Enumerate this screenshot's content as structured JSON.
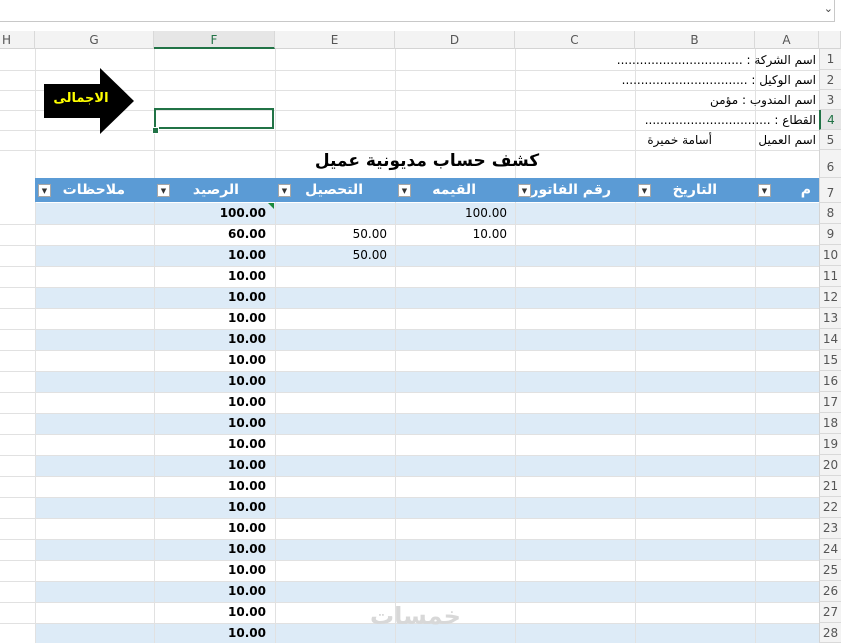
{
  "columns": [
    "H",
    "G",
    "F",
    "E",
    "D",
    "C",
    "B",
    "A"
  ],
  "rows": [
    "1",
    "2",
    "3",
    "4",
    "5",
    "6",
    "7",
    "8",
    "9",
    "10",
    "11",
    "12",
    "13",
    "14",
    "15",
    "16",
    "17",
    "18",
    "19",
    "20",
    "21",
    "22",
    "23",
    "24",
    "25",
    "26",
    "27",
    "28"
  ],
  "info": {
    "company": "اسم الشركة : .................................",
    "agent": "اسم الوكيل : .................................",
    "rep": "اسم المندوب : مؤمن",
    "sector": "القطاع : .................................",
    "client_label": "اسم العميل",
    "client_name": "أسامة خميرة"
  },
  "arrow_label": "الاجمالى",
  "table": {
    "title": "كشف حساب مديونية عميل",
    "headers": [
      "م",
      "التاريخ",
      "رقم الفاتورة",
      "القيمه",
      "التحصيل",
      "الرصيد",
      "ملاحظات"
    ],
    "value_col": [
      "100.00",
      "10.00"
    ],
    "collect_col": [
      "",
      "50.00",
      "50.00"
    ],
    "balance_col": [
      "100.00",
      "60.00",
      "10.00",
      "10.00",
      "10.00",
      "10.00",
      "10.00",
      "10.00",
      "10.00",
      "10.00",
      "10.00",
      "10.00",
      "10.00",
      "10.00",
      "10.00",
      "10.00",
      "10.00",
      "10.00",
      "10.00",
      "10.00",
      "10.00"
    ]
  },
  "formula_bar_chevron": "⌄",
  "watermark": "خمسات"
}
